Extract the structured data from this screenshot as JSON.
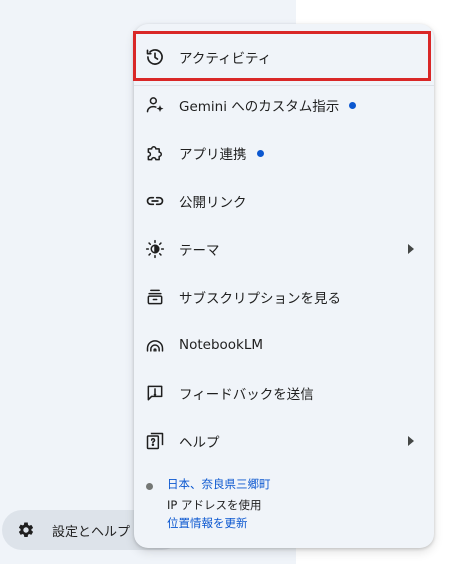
{
  "menu": {
    "items": [
      {
        "label": "アクティビティ",
        "icon": "history-icon"
      },
      {
        "label": "Gemini へのカスタム指示",
        "icon": "person-sparkle-icon",
        "badge": "new-dot"
      },
      {
        "label": "アプリ連携",
        "icon": "puzzle-icon",
        "badge": "new-dot"
      },
      {
        "label": "公開リンク",
        "icon": "link-icon"
      },
      {
        "label": "テーマ",
        "icon": "theme-icon",
        "submenu": true
      },
      {
        "label": "サブスクリプションを見る",
        "icon": "subscription-icon"
      },
      {
        "label": "NotebookLM",
        "icon": "notebooklm-icon"
      },
      {
        "label": "フィードバックを送信",
        "icon": "feedback-icon"
      },
      {
        "label": "ヘルプ",
        "icon": "help-icon",
        "submenu": true
      }
    ],
    "location": {
      "place": "日本、奈良県三郷町",
      "source": "IP アドレスを使用",
      "update_link": "位置情報を更新"
    }
  },
  "sidebar": {
    "settings_label": "設定とヘルプ"
  },
  "colors": {
    "accent_blue": "#0b57d0",
    "highlight_red": "#d92727",
    "menu_bg": "#f0f4f9"
  }
}
